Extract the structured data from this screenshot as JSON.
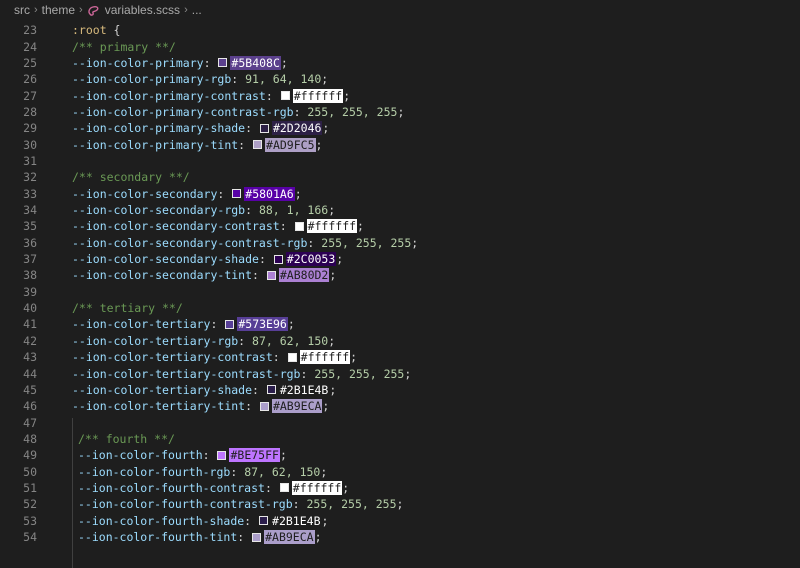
{
  "breadcrumb": {
    "items": [
      "src",
      "theme",
      "variables.scss",
      "..."
    ],
    "file_icon": "sass-file-icon"
  },
  "editor": {
    "lines": [
      {
        "n": "23",
        "kind": "open",
        "selector": ":root",
        "brace": " {"
      },
      {
        "n": "24",
        "kind": "comment",
        "text": "/** primary **/"
      },
      {
        "n": "25",
        "kind": "color",
        "prop": "--ion-color-primary",
        "hex": "#5B408C",
        "bg": "#5B408C",
        "fg": "#ffffff"
      },
      {
        "n": "26",
        "kind": "value",
        "prop": "--ion-color-primary-rgb",
        "value": "91, 64, 140"
      },
      {
        "n": "27",
        "kind": "color",
        "prop": "--ion-color-primary-contrast",
        "hex": "#ffffff",
        "bg": "#ffffff",
        "fg": "#1e1e1e"
      },
      {
        "n": "28",
        "kind": "value",
        "prop": "--ion-color-primary-contrast-rgb",
        "value": "255, 255, 255"
      },
      {
        "n": "29",
        "kind": "color",
        "prop": "--ion-color-primary-shade",
        "hex": "#2D2046",
        "bg": "#2D2046",
        "fg": "#ffffff"
      },
      {
        "n": "30",
        "kind": "color",
        "prop": "--ion-color-primary-tint",
        "hex": "#AD9FC5",
        "bg": "#AD9FC5",
        "fg": "#1e1e1e"
      },
      {
        "n": "31",
        "kind": "blank"
      },
      {
        "n": "32",
        "kind": "comment",
        "text": "/** secondary **/"
      },
      {
        "n": "33",
        "kind": "color",
        "prop": "--ion-color-secondary",
        "hex": "#5801A6",
        "bg": "#5801A6",
        "fg": "#ffffff"
      },
      {
        "n": "34",
        "kind": "value",
        "prop": "--ion-color-secondary-rgb",
        "value": "88, 1, 166"
      },
      {
        "n": "35",
        "kind": "color",
        "prop": "--ion-color-secondary-contrast",
        "hex": "#ffffff",
        "bg": "#ffffff",
        "fg": "#1e1e1e"
      },
      {
        "n": "36",
        "kind": "value",
        "prop": "--ion-color-secondary-contrast-rgb",
        "value": "255, 255, 255"
      },
      {
        "n": "37",
        "kind": "color",
        "prop": "--ion-color-secondary-shade",
        "hex": "#2C0053",
        "bg": "#2C0053",
        "fg": "#ffffff"
      },
      {
        "n": "38",
        "kind": "color",
        "prop": "--ion-color-secondary-tint",
        "hex": "#AB80D2",
        "bg": "#AB80D2",
        "fg": "#1e1e1e"
      },
      {
        "n": "39",
        "kind": "blank"
      },
      {
        "n": "40",
        "kind": "comment",
        "text": "/** tertiary **/"
      },
      {
        "n": "41",
        "kind": "color",
        "prop": "--ion-color-tertiary",
        "hex": "#573E96",
        "bg": "#573E96",
        "fg": "#ffffff"
      },
      {
        "n": "42",
        "kind": "value",
        "prop": "--ion-color-tertiary-rgb",
        "value": "87, 62, 150"
      },
      {
        "n": "43",
        "kind": "color",
        "prop": "--ion-color-tertiary-contrast",
        "hex": "#ffffff",
        "bg": "#ffffff",
        "fg": "#1e1e1e"
      },
      {
        "n": "44",
        "kind": "value",
        "prop": "--ion-color-tertiary-contrast-rgb",
        "value": "255, 255, 255"
      },
      {
        "n": "45",
        "kind": "color",
        "prop": "--ion-color-tertiary-shade",
        "hex": "#2B1E4B",
        "bg": "#1e1e1e",
        "fg": "#ffffff"
      },
      {
        "n": "46",
        "kind": "color",
        "prop": "--ion-color-tertiary-tint",
        "hex": "#AB9ECA",
        "bg": "#AB9ECA",
        "fg": "#1e1e1e"
      },
      {
        "n": "47",
        "kind": "blank"
      },
      {
        "n": "48",
        "kind": "comment",
        "indent": true,
        "text": "/** fourth **/"
      },
      {
        "n": "49",
        "kind": "color",
        "indent": true,
        "prop": "--ion-color-fourth",
        "hex": "#BE75FF",
        "bg": "#BE75FF",
        "fg": "#1e1e1e"
      },
      {
        "n": "50",
        "kind": "value",
        "indent": true,
        "prop": "--ion-color-fourth-rgb",
        "value": "87, 62, 150"
      },
      {
        "n": "51",
        "kind": "color",
        "indent": true,
        "prop": "--ion-color-fourth-contrast",
        "hex": "#ffffff",
        "bg": "#ffffff",
        "fg": "#1e1e1e"
      },
      {
        "n": "52",
        "kind": "value",
        "indent": true,
        "prop": "--ion-color-fourth-contrast-rgb",
        "value": "255, 255, 255"
      },
      {
        "n": "53",
        "kind": "color",
        "indent": true,
        "prop": "--ion-color-fourth-shade",
        "hex": "#2B1E4B",
        "bg": "#1e1e1e",
        "fg": "#ffffff"
      },
      {
        "n": "54",
        "kind": "color",
        "indent": true,
        "prop": "--ion-color-fourth-tint",
        "hex": "#AB9ECA",
        "bg": "#AB9ECA",
        "fg": "#1e1e1e"
      }
    ]
  }
}
